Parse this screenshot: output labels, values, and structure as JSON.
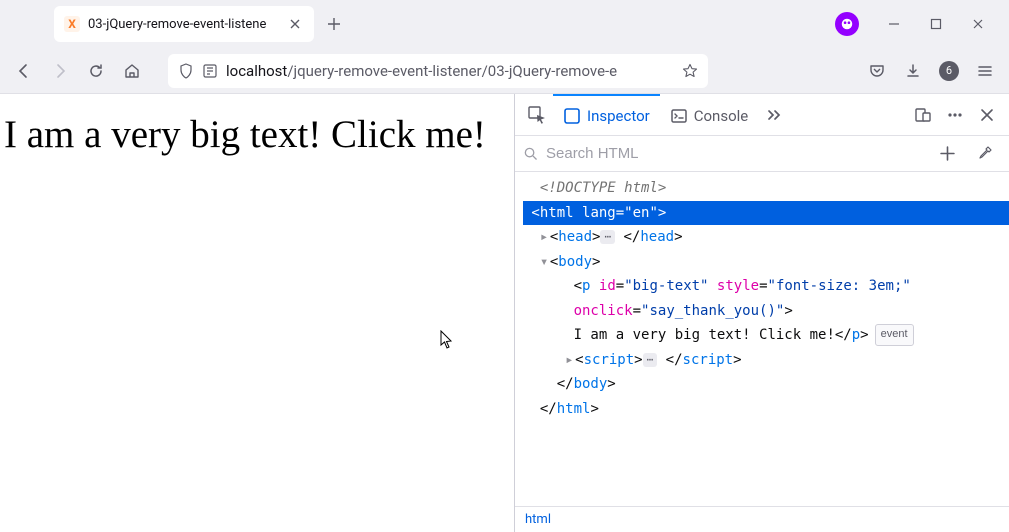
{
  "tab": {
    "title": "03-jQuery-remove-event-listene",
    "favicon": "X"
  },
  "url": {
    "host": "localhost",
    "path": "/jquery-remove-event-listener/03-jQuery-remove-e"
  },
  "toolbar": {
    "notif_count": "6"
  },
  "page": {
    "big_text": "I am a very big text! Click me!"
  },
  "devtools": {
    "tabs": {
      "inspector": "Inspector",
      "console": "Console"
    },
    "search_placeholder": "Search HTML",
    "breadcrumb": "html",
    "event_label": "event",
    "dom": {
      "doctype": "<!DOCTYPE html>",
      "html_open": "html",
      "html_lang_attr": "lang",
      "html_lang_val": "\"en\"",
      "head": "head",
      "body": "body",
      "p_tag": "p",
      "p_id_attr": "id",
      "p_id_val": "\"big-text\"",
      "p_style_attr": "style",
      "p_style_val": "\"font-size: 3em;\"",
      "p_onclick_attr": "onclick",
      "p_onclick_val": "\"say_thank_you()\"",
      "p_text": "I am a very big text! Click me!",
      "script": "script"
    }
  }
}
